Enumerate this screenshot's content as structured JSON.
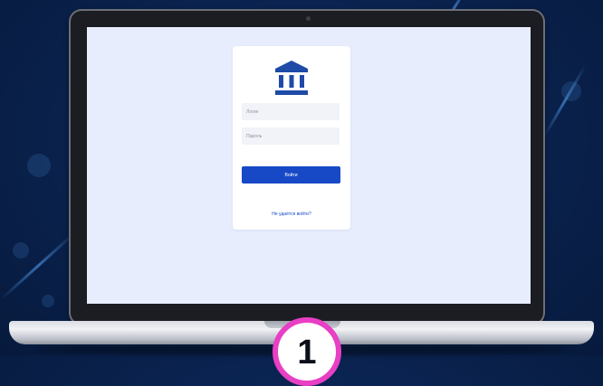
{
  "login_form": {
    "login_placeholder": "Логин",
    "password_placeholder": "Пароль",
    "submit_label": "Войти",
    "help_link": "Не удаётся войти?"
  },
  "step_badge": {
    "number": "1"
  },
  "colors": {
    "background": "#0a2350",
    "screen": "#e8edfd",
    "accent": "#1749c7",
    "badge_border": "#e83fc4"
  },
  "icons": {
    "logo": "bank-building-icon"
  }
}
